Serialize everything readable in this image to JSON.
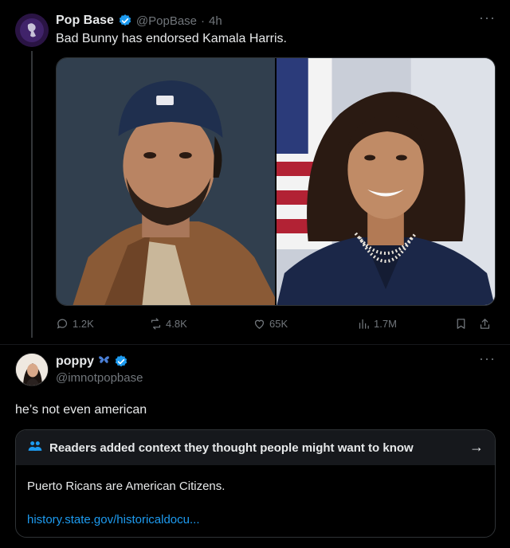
{
  "post": {
    "author_name": "Pop Base",
    "handle": "@PopBase",
    "separator": "·",
    "time": "4h",
    "text": "Bad Bunny has endorsed Kamala Harris.",
    "more": "···",
    "stats": {
      "replies": "1.2K",
      "reposts": "4.8K",
      "likes": "65K",
      "views": "1.7M"
    }
  },
  "reply": {
    "author_name": "poppy",
    "handle": "@imnotpopbase",
    "text": "he’s not even american",
    "more": "···"
  },
  "community_note": {
    "title": "Readers added context they thought people might want to know",
    "arrow": "→",
    "body": "Puerto Ricans are American Citizens.",
    "link": "history.state.gov/historicaldocu..."
  },
  "colors": {
    "background": "#000000",
    "text": "#e7e9ea",
    "muted": "#71767b",
    "accent": "#1d9bf0",
    "note_header": "#16181c"
  },
  "icons": [
    "verified-badge-icon",
    "reply-icon",
    "repost-icon",
    "like-icon",
    "views-icon",
    "bookmark-icon",
    "share-icon",
    "butterfly-icon",
    "readers-icon"
  ]
}
